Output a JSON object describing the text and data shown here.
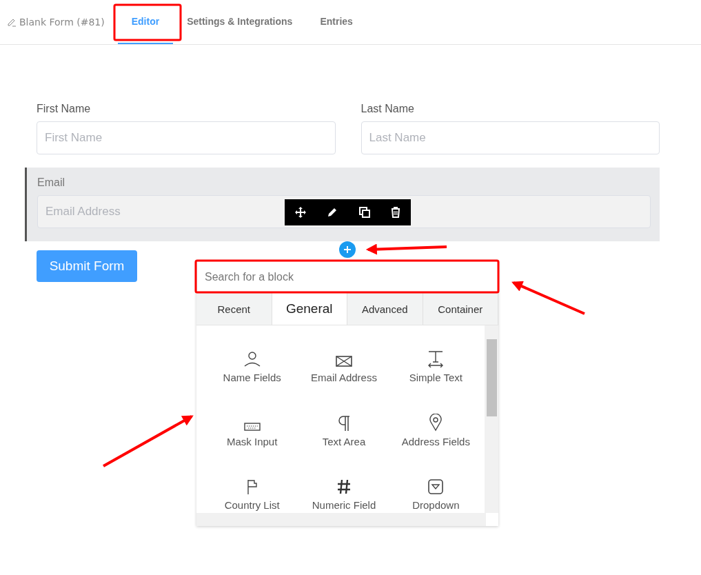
{
  "header": {
    "form_title": "Blank Form (#81)",
    "tabs": [
      {
        "label": "Editor",
        "selected": true
      },
      {
        "label": "Settings & Integrations",
        "selected": false
      },
      {
        "label": "Entries",
        "selected": false
      }
    ]
  },
  "form": {
    "row": [
      {
        "label": "First Name",
        "placeholder": "First Name"
      },
      {
        "label": "Last Name",
        "placeholder": "Last Name"
      }
    ],
    "email": {
      "label": "Email",
      "placeholder": "Email Address",
      "selected": true
    },
    "submit": "Submit Form"
  },
  "picker": {
    "search": {
      "placeholder": "Search for a block"
    },
    "tabs": [
      {
        "label": "Recent",
        "selected": false
      },
      {
        "label": "General",
        "selected": true
      },
      {
        "label": "Advanced",
        "selected": false
      },
      {
        "label": "Container",
        "selected": false
      }
    ],
    "blocks": [
      {
        "label": "Name Fields",
        "kind": "person"
      },
      {
        "label": "Email Address",
        "kind": "envelope"
      },
      {
        "label": "Simple Text",
        "kind": "text"
      },
      {
        "label": "Mask Input",
        "kind": "keyboard"
      },
      {
        "label": "Text Area",
        "kind": "paragraph"
      },
      {
        "label": "Address Fields",
        "kind": "pin"
      },
      {
        "label": "Country List",
        "kind": "flag"
      },
      {
        "label": "Numeric Field",
        "kind": "hash"
      },
      {
        "label": "Dropdown",
        "kind": "dropdown"
      }
    ]
  }
}
